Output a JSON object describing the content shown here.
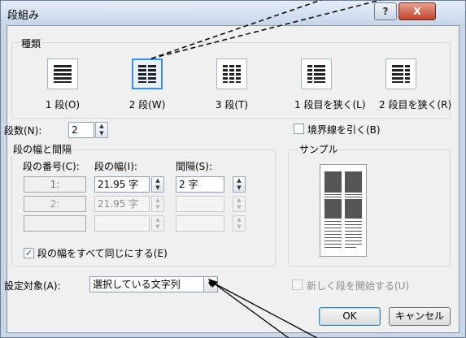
{
  "dialog": {
    "title": "段組み",
    "help_label": "?",
    "close_label": "X"
  },
  "presets": {
    "group_label": "種類",
    "items": [
      {
        "label": "1 段(O)",
        "selected": false,
        "cols": 1
      },
      {
        "label": "2 段(W)",
        "selected": true,
        "cols": 2
      },
      {
        "label": "3 段(T)",
        "selected": false,
        "cols": 3
      },
      {
        "label": "1 段目を狭く(L)",
        "selected": false,
        "cols": "left"
      },
      {
        "label": "2 段目を狭く(R)",
        "selected": false,
        "cols": "right"
      }
    ]
  },
  "columns_count": {
    "label": "段数(N):",
    "value": "2"
  },
  "width_spacing": {
    "group_label": "段の幅と間隔",
    "col_header": "段の番号(C):",
    "width_header": "段の幅(I):",
    "spacing_header": "間隔(S):",
    "rows": [
      {
        "num": "1:",
        "width": "21.95 字",
        "spacing": "2 字"
      },
      {
        "num": "2:",
        "width": "21.95 字",
        "spacing": ""
      },
      {
        "num": "",
        "width": "",
        "spacing": ""
      }
    ]
  },
  "equal_width": {
    "label": "段の幅をすべて同じにする(E)",
    "checked": true
  },
  "line_between": {
    "label": "境界線を引く(B)",
    "checked": false
  },
  "preview": {
    "label": "サンプル"
  },
  "apply_to": {
    "label": "設定対象(A):",
    "value": "選択している文字列"
  },
  "new_column": {
    "label": "新しく段を開始する(U)",
    "checked": false
  },
  "buttons": {
    "ok": "OK",
    "cancel": "キャンセル"
  },
  "colors": {
    "accent": "#3a8ee6",
    "close": "#c0432b"
  }
}
